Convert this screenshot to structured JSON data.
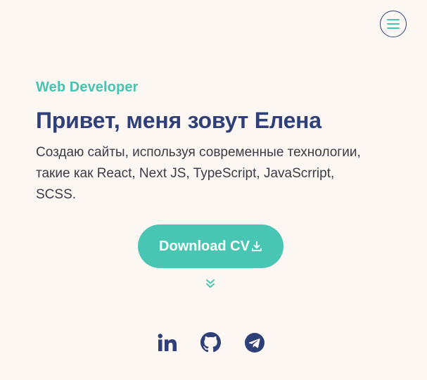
{
  "header": {
    "menu_icon": "hamburger-menu-icon"
  },
  "hero": {
    "role": "Web Developer",
    "title": "Привет, меня зовут Елена",
    "description_line1": "Создаю сайты, используя современные технологии,",
    "description_line2": "такие как React, Next JS, TypeScript, JavaScrript,",
    "description_line3": "SCSS."
  },
  "cta": {
    "label": "Download CV",
    "icon": "download-icon"
  },
  "scroll_icon": "chevron-double-down-icon",
  "social": {
    "items": [
      "linkedin-icon",
      "github-icon",
      "telegram-icon"
    ]
  },
  "colors": {
    "background": "#fdf7f3",
    "accent": "#48c6b3",
    "primary_text": "#2f3f78",
    "body_text": "#3b3b46"
  }
}
